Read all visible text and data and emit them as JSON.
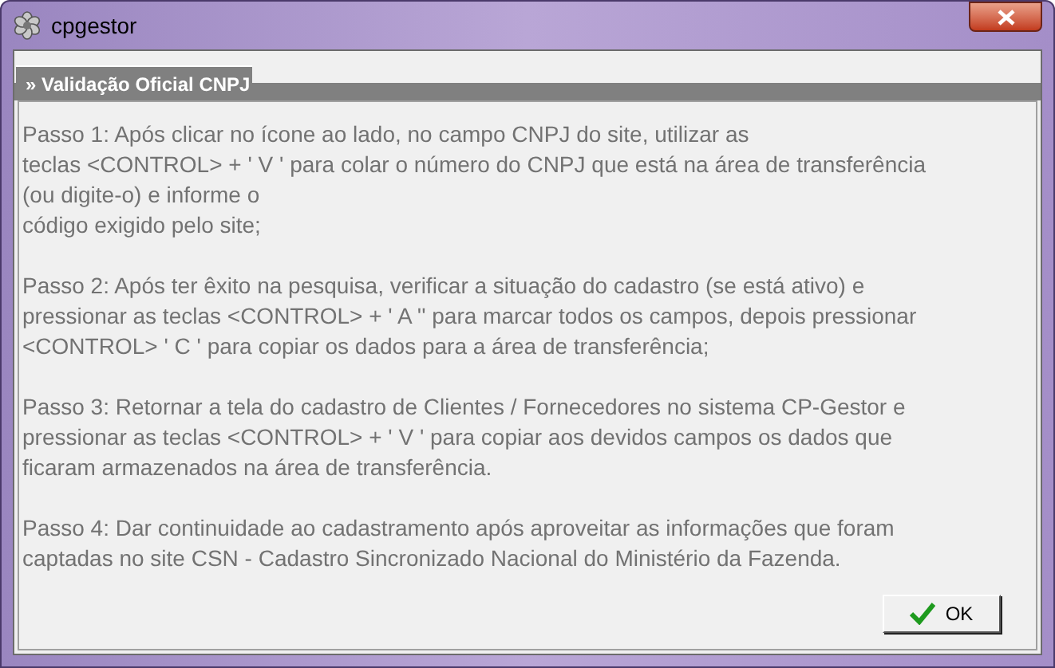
{
  "window": {
    "title": "cpgestor"
  },
  "panel": {
    "title": "» Validação Oficial CNPJ"
  },
  "paragraphs": [
    {
      "lines": [
        "Passo 1: Após clicar no ícone ao lado, no campo CNPJ do site, utilizar as",
        "teclas <CONTROL> + ' V ' para colar o número do CNPJ que está na área de transferência",
        "(ou digite-o) e informe o",
        "código exigido pelo site;"
      ]
    },
    {
      "lines": [
        "Passo 2: Após ter êxito na pesquisa, verificar a situação do cadastro (se está ativo) e",
        "pressionar as teclas <CONTROL> + ' A '' para marcar todos os campos, depois pressionar",
        "<CONTROL> ' C ' para copiar os dados para a área de transferência;"
      ]
    },
    {
      "lines": [
        "Passo 3: Retornar a tela do cadastro de Clientes / Fornecedores no sistema CP-Gestor e",
        "pressionar as teclas <CONTROL> + ' V ' para copiar aos devidos campos os dados que",
        "ficaram armazenados na área de transferência."
      ]
    },
    {
      "lines": [
        "Passo 4: Dar continuidade ao cadastramento após aproveitar as informações que foram",
        "captadas no site CSN - Cadastro Sincronizado Nacional do Ministério da Fazenda."
      ]
    }
  ],
  "ok_button": {
    "label": "OK"
  }
}
